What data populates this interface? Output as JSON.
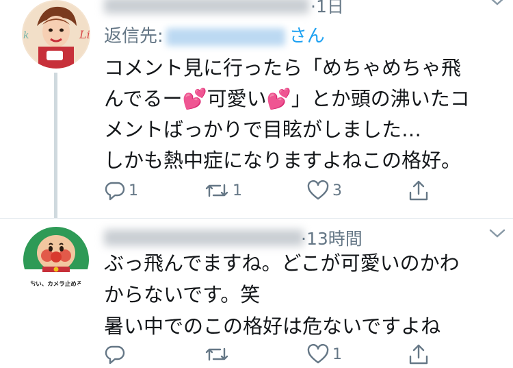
{
  "tweets": [
    {
      "time": "·1日",
      "reply_prefix": "返信先:",
      "reply_suffix": "さん",
      "text": "コメント見に行ったら「めちゃめちゃ飛\nんでるー💕可愛い💕」とか頭の沸いたコ\nメントばっかりで目眩がしました…\nしかも熱中症になりますよねこの格好。",
      "reply_count": "1",
      "retweet_count": "1",
      "like_count": "3"
    },
    {
      "time": "·13時間",
      "avatar_caption": "おい、カメラ止めろ",
      "text": "ぶっ飛んでますね。どこが可愛いのかわ\nからないです。笑\n暑い中でのこの格好は危ないですよね",
      "reply_count": "",
      "retweet_count": "",
      "like_count": "1"
    }
  ],
  "icons": {
    "reply": "reply-icon",
    "retweet": "retweet-icon",
    "like": "heart-icon",
    "share": "share-icon",
    "more": "chevron-down-icon"
  },
  "colors": {
    "secondary_text": "#657786",
    "link": "#1da1f2",
    "thread_line": "#cfd9de"
  }
}
